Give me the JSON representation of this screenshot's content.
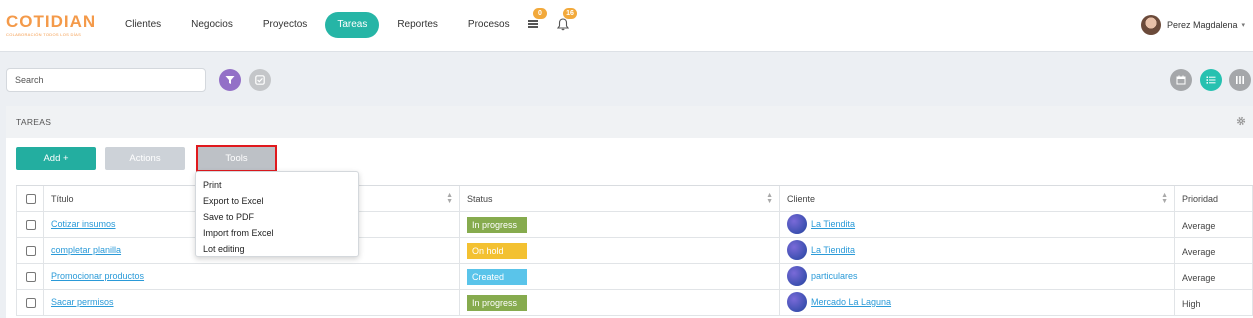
{
  "logo": {
    "brand": "COTIDIAN",
    "tagline": "COLABORACIÓN TODOS LOS DÍAS",
    "color": "#f49a4a"
  },
  "nav": {
    "items": [
      {
        "label": "Clientes"
      },
      {
        "label": "Negocios"
      },
      {
        "label": "Proyectos"
      },
      {
        "label": "Tareas",
        "active": true
      },
      {
        "label": "Reportes"
      },
      {
        "label": "Procesos"
      }
    ],
    "accent": "#26b5a6"
  },
  "notifications": {
    "messages_count": "0",
    "alerts_count": "16",
    "badge_color": "#f2a93b"
  },
  "user": {
    "name": "Perez Magdalena"
  },
  "search": {
    "placeholder": "Search",
    "value": ""
  },
  "view_toggles": {
    "active": "list"
  },
  "panel": {
    "title": "TAREAS"
  },
  "toolbar": {
    "add_label": "Add +",
    "actions_label": "Actions",
    "tools_label": "Tools"
  },
  "tools_menu": {
    "items": [
      {
        "label": "Print"
      },
      {
        "label": "Export to Excel"
      },
      {
        "label": "Save to PDF"
      },
      {
        "label": "Import from Excel"
      },
      {
        "label": "Lot editing"
      }
    ]
  },
  "table": {
    "columns": {
      "title": "Título",
      "status": "Status",
      "client": "Cliente",
      "priority": "Prioridad"
    },
    "rows": [
      {
        "title": "Cotizar insumos",
        "status": "In progress",
        "status_color": "#86ab4e",
        "client": "La Tiendita",
        "priority": "Average"
      },
      {
        "title": "completar planilla",
        "status": "On hold",
        "status_color": "#f3c131",
        "client": "La Tiendita",
        "priority": "Average"
      },
      {
        "title": "Promocionar productos",
        "status": "Created",
        "status_color": "#5ac4ea",
        "client": "particulares",
        "priority": "Average"
      },
      {
        "title": "Sacar permisos",
        "status": "In progress",
        "status_color": "#86ab4e",
        "client": "Mercado La Laguna",
        "priority": "High"
      }
    ]
  }
}
